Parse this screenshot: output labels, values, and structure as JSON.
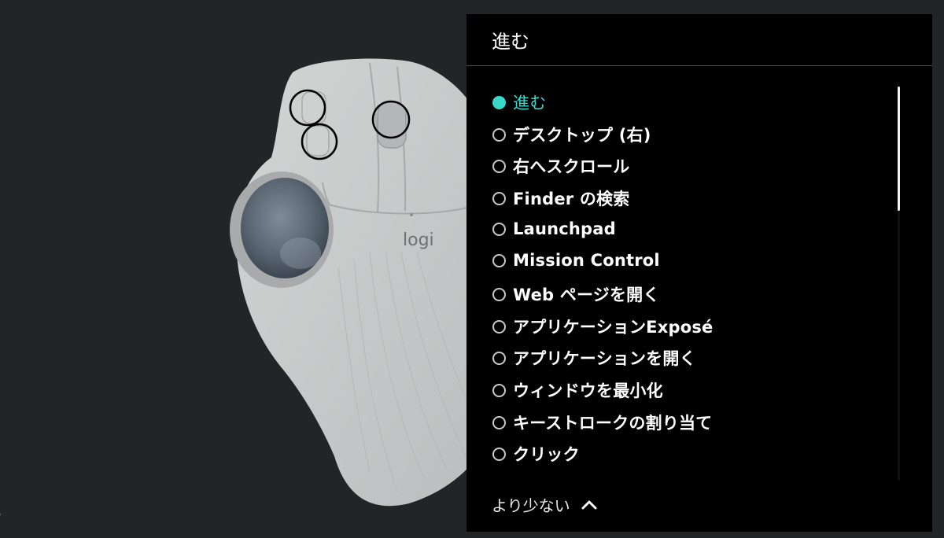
{
  "device": {
    "brand_logo": "logi",
    "colors": {
      "body": "#c7c8c8",
      "shadow": "#9ea0a1",
      "ball": "#5d6a76",
      "highlight_ring": "#000000"
    }
  },
  "panel": {
    "title": "進む",
    "options": [
      {
        "label": "進む",
        "selected": true
      },
      {
        "label": "デスクトップ (右)",
        "selected": false
      },
      {
        "label": "右へスクロール",
        "selected": false
      },
      {
        "label": "Finder の検索",
        "selected": false
      },
      {
        "label": "Launchpad",
        "selected": false
      },
      {
        "label": "Mission Control",
        "selected": false
      },
      {
        "label": "Web ページを開く",
        "selected": false
      },
      {
        "label": "アプリケーションExposé",
        "selected": false
      },
      {
        "label": "アプリケーションを開く",
        "selected": false
      },
      {
        "label": "ウィンドウを最小化",
        "selected": false
      },
      {
        "label": "キーストロークの割り当て",
        "selected": false
      },
      {
        "label": "クリック",
        "selected": false
      }
    ],
    "collapse_label": "より少ない",
    "accent_color": "#3ad8cb"
  },
  "icons": {
    "collapse": "chevron-up-icon"
  }
}
